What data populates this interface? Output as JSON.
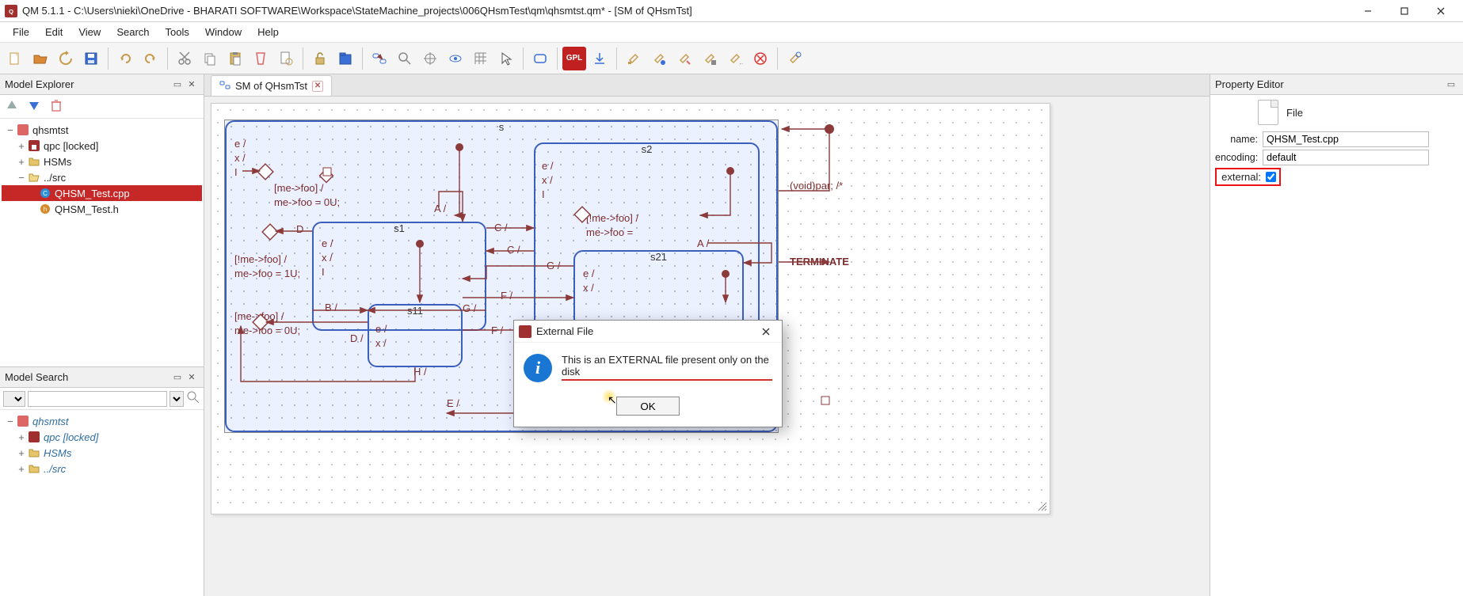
{
  "window": {
    "title": "QM 5.1.1 - C:\\Users\\nieki\\OneDrive - BHARATI SOFTWARE\\Workspace\\StateMachine_projects\\006QHsmTest\\qm\\qhsmtst.qm* - [SM of QHsmTst]"
  },
  "menu": [
    "File",
    "Edit",
    "View",
    "Search",
    "Tools",
    "Window",
    "Help"
  ],
  "panels": {
    "explorer": "Model Explorer",
    "search": "Model Search",
    "property": "Property Editor",
    "file_label": "File"
  },
  "tree": {
    "root": "qhsmtst",
    "items": [
      {
        "label": "qpc [locked]",
        "icon": "pkg-lock"
      },
      {
        "label": "HSMs",
        "icon": "folder"
      },
      {
        "label": "../src",
        "icon": "folder-open",
        "children": [
          {
            "label": "QHSM_Test.cpp",
            "icon": "cpp",
            "selected": true
          },
          {
            "label": "QHSM_Test.h",
            "icon": "h"
          }
        ]
      }
    ]
  },
  "search_tree": {
    "root": "qhsmtst",
    "items": [
      {
        "label": "qpc [locked]"
      },
      {
        "label": "HSMs"
      },
      {
        "label": "../src"
      }
    ]
  },
  "tab": {
    "title": "SM of QHsmTst"
  },
  "diagram": {
    "states": {
      "s": "s",
      "s1": "s1",
      "s11": "s11",
      "s2": "s2",
      "s21": "s21"
    },
    "texts": {
      "e_s": "e /",
      "x_s": "x /",
      "I_s": "I",
      "guard_s": "[me->foo] /",
      "act_s": "me->foo = 0U;",
      "A": "A /",
      "D": "D",
      "Ds": "D /",
      "C": "C /",
      "B": "B /",
      "G": "G /",
      "F": "F /",
      "H": "H /",
      "E": "E /",
      "e_s1": "e /",
      "x_s1": "x /",
      "I_s1": "I",
      "guard_s1": "[!me->foo] /",
      "act_s1": "me->foo = 1U;",
      "e_s11": "e /",
      "x_s11": "x /",
      "guard_b": "[me->foo] /",
      "act_b": "me->foo = 0U;",
      "e_s2": "e /",
      "x_s2": "x /",
      "I_s2": "I",
      "guard_s2": "[!me->foo] /",
      "act_s2": "me->foo =",
      "e_s21": "e /",
      "x_s21": "x /",
      "A2": "A /",
      "voidpar": "(void)par; /*",
      "terminate": "TERMINATE"
    }
  },
  "property": {
    "name_label": "name:",
    "name_value": "QHSM_Test.cpp",
    "encoding_label": "encoding:",
    "encoding_value": "default",
    "external_label": "external:"
  },
  "dialog": {
    "title": "External File",
    "message": "This is an EXTERNAL file present only on the disk",
    "ok": "OK"
  }
}
